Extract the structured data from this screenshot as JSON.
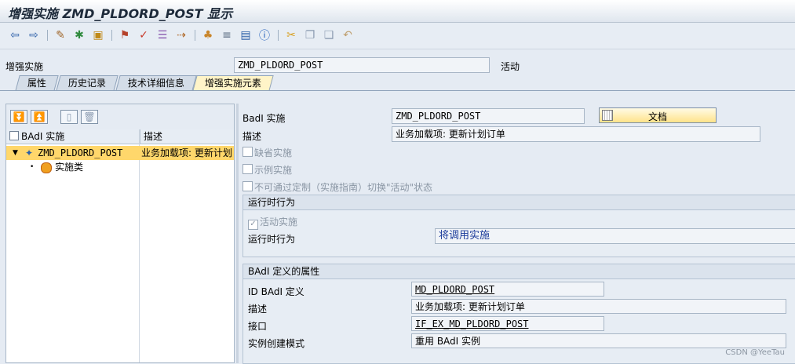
{
  "window": {
    "title": "增强实施 ZMD_PLDORD_POST 显示"
  },
  "header": {
    "label": "增强实施",
    "value": "ZMD_PLDORD_POST",
    "status": "活动"
  },
  "tabs": [
    "属性",
    "历史记录",
    "技术详细信息",
    "增强实施元素"
  ],
  "tree": {
    "col_badi": "BAdI 实施",
    "col_desc": "描述",
    "root": {
      "name": "ZMD_PLDORD_POST",
      "desc": "业务加载项: 更新计划"
    },
    "child": {
      "name": "实施类"
    }
  },
  "detail": {
    "badi_impl_label": "BadI 实施",
    "badi_impl_value": "ZMD_PLDORD_POST",
    "doc_button": "文档",
    "desc_label": "描述",
    "desc_value": "业务加载项: 更新计划订单",
    "cb_default": "缺省实施",
    "cb_example": "示例实施",
    "cb_no_switch": "不可通过定制（实施指南）切换\"活动\"状态"
  },
  "runtime": {
    "title": "运行时行为",
    "active_label": "活动实施",
    "behavior_label": "运行时行为",
    "behavior_value": "将调用实施"
  },
  "badi_def": {
    "title": "BAdI 定义的属性",
    "id_label": "ID BAdI 定义",
    "id_value": "MD_PLDORD_POST",
    "desc_label": "描述",
    "desc_value": "业务加载项: 更新计划订单",
    "interface_label": "接口",
    "interface_value": "IF_EX_MD_PLDORD_POST",
    "inst_label": "实例创建模式",
    "inst_value": "重用 BAdI 实例"
  },
  "watermark": "CSDN @YeeTau"
}
